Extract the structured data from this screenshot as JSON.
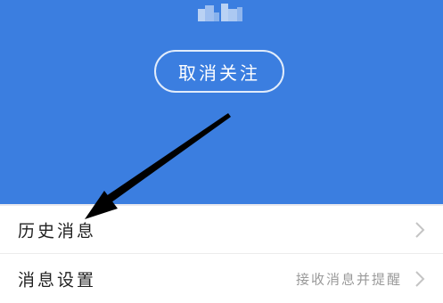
{
  "header": {
    "background_color": "#3b7ee0",
    "unfollow_button_label": "取消关注"
  },
  "list": [
    {
      "label": "历史消息",
      "subtext": "",
      "icon": "chevron-right-icon"
    },
    {
      "label": "消息设置",
      "subtext": "接收消息并提醒",
      "icon": "chevron-right-icon"
    }
  ],
  "annotation": {
    "icon": "pointer-arrow-icon",
    "color": "#000000"
  }
}
